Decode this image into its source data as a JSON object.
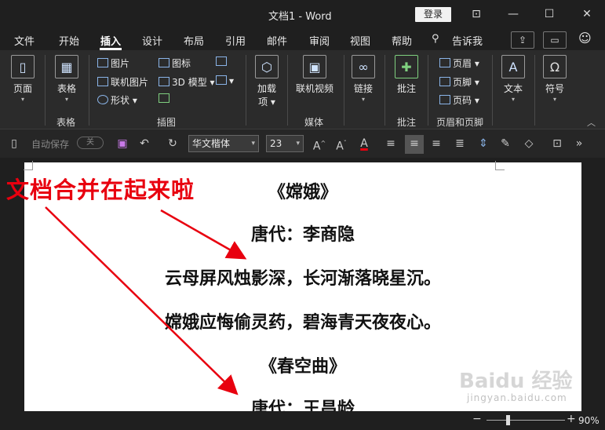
{
  "titlebar": {
    "title": "文档1  -  Word",
    "login": "登录"
  },
  "menu": {
    "items": [
      "文件",
      "开始",
      "插入",
      "设计",
      "布局",
      "引用",
      "邮件",
      "审阅",
      "视图",
      "帮助",
      "告诉我"
    ],
    "active": "插入"
  },
  "ribbon": {
    "page_btn": "页面",
    "table_btn": "表格",
    "group_table": "表格",
    "pictures": "图片",
    "online_pictures": "联机图片",
    "shapes": "形状",
    "icons": "图标",
    "model3d": "3D 模型",
    "group_illustrations": "插图",
    "addins": "加载\n项",
    "online_video": "联机视频",
    "group_media": "媒体",
    "link": "链接",
    "comment": "批注",
    "group_comment": "批注",
    "header": "页眉",
    "footer": "页脚",
    "page_number": "页码",
    "group_header_footer": "页眉和页脚",
    "text": "文本",
    "symbol": "符号"
  },
  "qat": {
    "autosave": "自动保存",
    "autosave_state": "关",
    "font_name": "华文楷体",
    "font_size": "23"
  },
  "document": {
    "lines": [
      "《嫦娥》",
      "唐代：李商隐",
      "云母屏风烛影深，长河渐落晓星沉。",
      "嫦娥应悔偷灵药，碧海青天夜夜心。",
      "《春空曲》",
      "唐代：王昌龄"
    ]
  },
  "annotation": "文档合并在起来啦",
  "status": {
    "zoom": "90%"
  },
  "watermark": {
    "brand": "Baidu 经验",
    "site": "jingyan.baidu.com"
  },
  "colors": {
    "accent_red": "#e8000f",
    "dark_bg": "#1f1f1f",
    "ribbon_bg": "#2b2b2b"
  }
}
